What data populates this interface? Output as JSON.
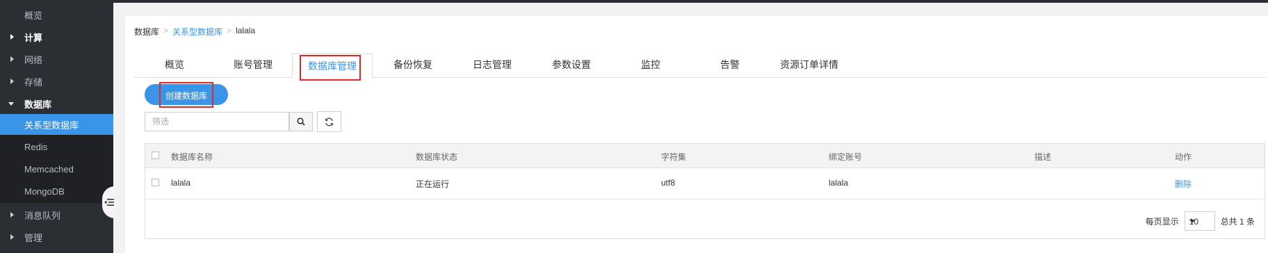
{
  "sidebar": {
    "items": [
      {
        "label": "概览"
      },
      {
        "label": "计算"
      },
      {
        "label": "网络"
      },
      {
        "label": "存储"
      },
      {
        "label": "数据库"
      },
      {
        "label": "关系型数据库"
      },
      {
        "label": "Redis"
      },
      {
        "label": "Memcached"
      },
      {
        "label": "MongoDB"
      },
      {
        "label": "消息队列"
      },
      {
        "label": "管理"
      }
    ]
  },
  "breadcrumb": {
    "root": "数据库",
    "sep": ">",
    "parent": "关系型数据库",
    "current": "lalala"
  },
  "tabs": [
    "概览",
    "账号管理",
    "数据库管理",
    "备份恢复",
    "日志管理",
    "参数设置",
    "监控",
    "告警",
    "资源订单详情"
  ],
  "toolbar": {
    "create_label": "创建数据库",
    "filter_placeholder": "筛选"
  },
  "table": {
    "headers": [
      "数据库名称",
      "数据库状态",
      "字符集",
      "绑定账号",
      "描述",
      "动作"
    ],
    "rows": [
      {
        "name": "lalala",
        "status": "正在运行",
        "charset": "utf8",
        "account": "lalala",
        "desc": "",
        "action": "删除"
      }
    ]
  },
  "pagination": {
    "per_page_label": "每页显示",
    "per_page_value": "10",
    "total": "总共 1 条"
  },
  "colors": {
    "accent": "#3a95e8",
    "sidebar_bg": "#2b2e32",
    "highlight": "#e3262c"
  }
}
